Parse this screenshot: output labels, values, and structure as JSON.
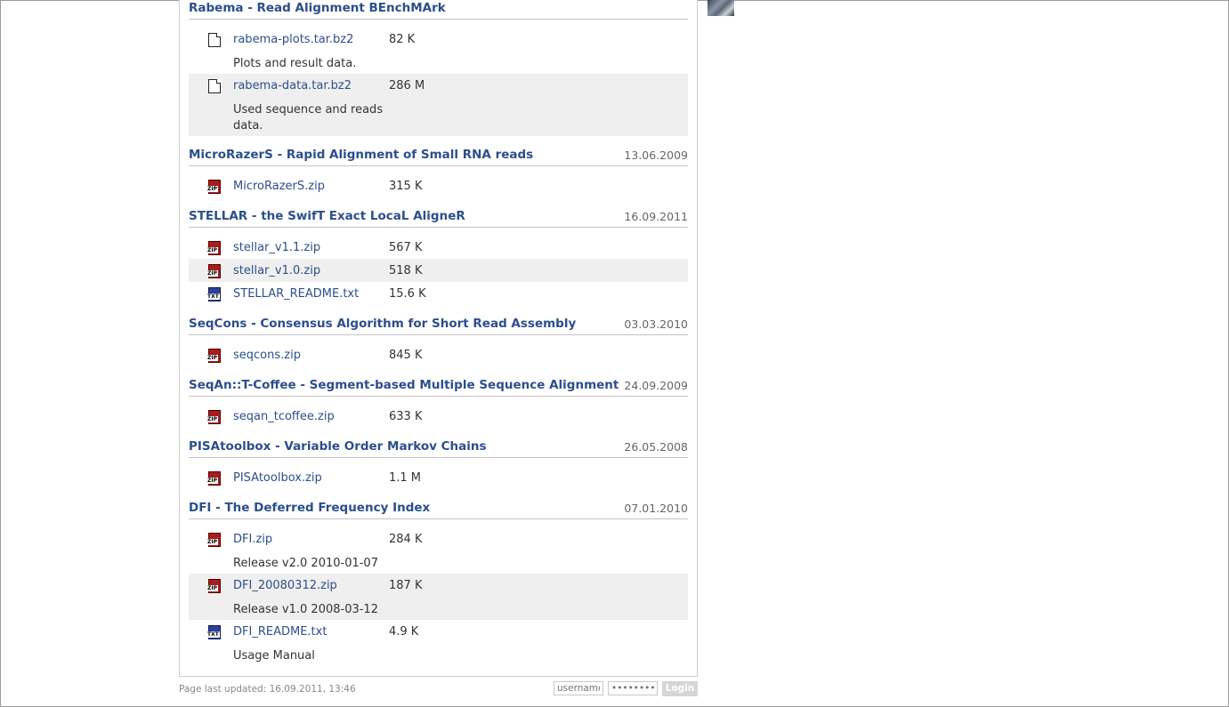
{
  "sections": [
    {
      "title": "Rabema - Read Alignment BEnchMArk",
      "date": "",
      "files": [
        {
          "name": "rabema-plots.tar.bz2",
          "size": "82 K",
          "type": "doc",
          "desc": "Plots and result data."
        },
        {
          "name": "rabema-data.tar.bz2",
          "size": "286 M",
          "type": "doc",
          "desc": "Used sequence and reads data."
        }
      ]
    },
    {
      "title": "MicroRazerS - Rapid Alignment of Small RNA reads",
      "date": "13.06.2009",
      "files": [
        {
          "name": "MicroRazerS.zip",
          "size": "315 K",
          "type": "zip",
          "desc": ""
        }
      ]
    },
    {
      "title": "STELLAR - the SwifT Exact LocaL AligneR",
      "date": "16.09.2011",
      "files": [
        {
          "name": "stellar_v1.1.zip",
          "size": "567 K",
          "type": "zip",
          "desc": ""
        },
        {
          "name": "stellar_v1.0.zip",
          "size": "518 K",
          "type": "zip",
          "desc": ""
        },
        {
          "name": "STELLAR_README.txt",
          "size": "15.6 K",
          "type": "txt",
          "desc": ""
        }
      ]
    },
    {
      "title": "SeqCons - Consensus Algorithm for Short Read Assembly",
      "date": "03.03.2010",
      "files": [
        {
          "name": "seqcons.zip",
          "size": "845 K",
          "type": "zip",
          "desc": ""
        }
      ]
    },
    {
      "title": "SeqAn::T-Coffee - Segment-based Multiple Sequence Alignment",
      "date": "24.09.2009",
      "files": [
        {
          "name": "seqan_tcoffee.zip",
          "size": "633 K",
          "type": "zip",
          "desc": ""
        }
      ]
    },
    {
      "title": "PISAtoolbox - Variable Order Markov Chains",
      "date": "26.05.2008",
      "files": [
        {
          "name": "PISAtoolbox.zip",
          "size": "1.1 M",
          "type": "zip",
          "desc": ""
        }
      ]
    },
    {
      "title": "DFI - The Deferred Frequency Index",
      "date": "07.01.2010",
      "files": [
        {
          "name": "DFI.zip",
          "size": "284 K",
          "type": "zip",
          "desc": "Release v2.0 2010-01-07"
        },
        {
          "name": "DFI_20080312.zip",
          "size": "187 K",
          "type": "zip",
          "desc": "Release v1.0 2008-03-12"
        },
        {
          "name": "DFI_README.txt",
          "size": "4.9 K",
          "type": "txt",
          "desc": "Usage Manual"
        }
      ]
    }
  ],
  "footer": {
    "last_updated": "Page last updated: 16.09.2011, 13:46",
    "username_placeholder": "username",
    "password_placeholder": "••••••••",
    "login_label": "Login"
  },
  "icons": {
    "zip_label": "ZIP",
    "txt_label": "TXT"
  },
  "colors": {
    "link": "#2b4f8c",
    "alt_row": "#efefef"
  }
}
